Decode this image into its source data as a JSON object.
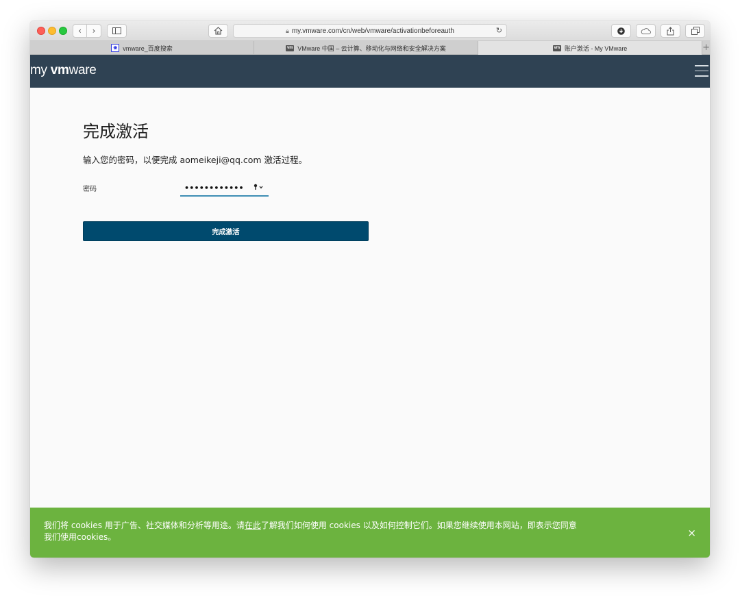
{
  "browser": {
    "address": "my.vmware.com/cn/web/vmware/activationbeforeauth",
    "tabs": [
      {
        "title": "vmware_百度搜索",
        "icon": "baidu-paw-icon",
        "active": false
      },
      {
        "title": "VMware 中国 – 云计算、移动化与网络和安全解决方案",
        "icon": "vmware-favicon",
        "active": false
      },
      {
        "title": "账户激活 - My VMware",
        "icon": "vmware-favicon",
        "active": true
      }
    ],
    "new_tab": "+"
  },
  "header": {
    "logo_my": "my",
    "logo_vm": "vm",
    "logo_ware": "ware"
  },
  "main": {
    "title": "完成激活",
    "description": "输入您的密码，以便完成 aomeikeji@qq.com 激活过程。",
    "password_label": "密码",
    "password_mask": "••••••••••••",
    "submit_label": "完成激活"
  },
  "cookie_banner": {
    "text_before": "我们将 cookies 用于广告、社交媒体和分析等用途。请",
    "link_text": "在此",
    "text_after": "了解我们如何使用 cookies 以及如何控制它们。如果您继续使用本网站，即表示您同意我们使用cookies。",
    "close": "×",
    "color": "#6cb33f"
  },
  "colors": {
    "header": "#2f4253",
    "button": "#004a6e",
    "field_underline": "#3d8db3"
  }
}
